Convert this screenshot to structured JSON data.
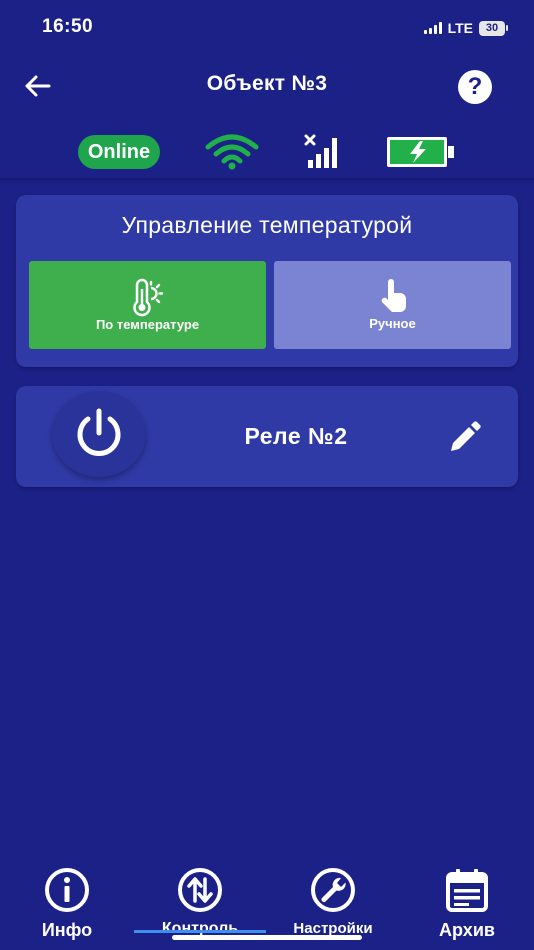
{
  "status_bar": {
    "time": "16:50",
    "network": "LTE",
    "battery": "30"
  },
  "header": {
    "title": "Объект №3",
    "back_icon": "arrow-left-icon",
    "help_label": "?"
  },
  "device_status": {
    "online_label": "Online",
    "wifi_icon": "wifi-icon",
    "cellular_icon": "cellular-no-signal-icon",
    "battery_icon": "battery-charging-icon"
  },
  "temperature_control": {
    "title": "Управление температурой",
    "modes": [
      {
        "label": "По температуре",
        "icon": "thermometer-sun-icon",
        "active": true
      },
      {
        "label": "Ручное",
        "icon": "hand-pointer-icon",
        "active": false
      }
    ]
  },
  "relay": {
    "title": "Реле №2",
    "power_icon": "power-icon",
    "edit_icon": "pencil-icon"
  },
  "bottom_nav": {
    "items": [
      {
        "label": "Инфо",
        "icon": "info-icon"
      },
      {
        "label": "Контроль",
        "icon": "swap-vertical-icon",
        "active": true
      },
      {
        "label": "Настройки",
        "icon": "wrench-icon"
      },
      {
        "label": "Архив",
        "icon": "calendar-icon"
      }
    ]
  },
  "colors": {
    "background": "#1c2188",
    "card": "#2f3aa7",
    "active_mode": "#3fae4c",
    "inactive_mode": "#7b84d2",
    "online": "#1fa54b",
    "nav_indicator": "#3f8ff0"
  }
}
